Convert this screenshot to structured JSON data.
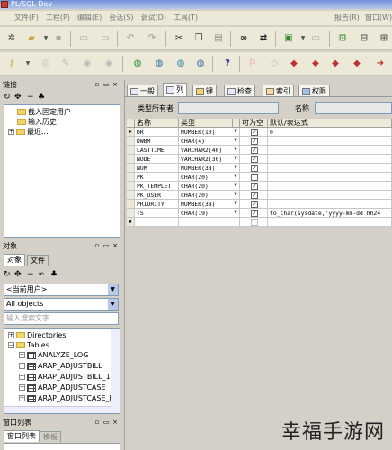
{
  "window": {
    "title": "PL/SQL Dev"
  },
  "menu": {
    "items": [
      "文件(F)",
      "工程(P)",
      "编辑(E)",
      "会话(S)",
      "调试(D)",
      "工具(T)"
    ],
    "right": [
      "报告(R)",
      "窗口(W)"
    ]
  },
  "left_panel": {
    "browser_title": "链接",
    "browser_items": [
      "截入固定用户",
      "输入历史",
      "最近..."
    ],
    "objects_title": "对象",
    "object_tabs": [
      "对象",
      "文件"
    ],
    "user_select": "<当前用户>",
    "type_select": "All objects",
    "search_placeholder": "输入搜索文字",
    "tree": [
      "Directories",
      "Tables",
      "ANALYZE_LOG",
      "ARAP_ADJUSTBILL",
      "ARAP_ADJUSTBILL_1",
      "ARAP_ADJUSTCASE",
      "ARAP_ADJUSTCASE_I"
    ],
    "windows_title": "窗口列表",
    "windows_tabs": [
      "窗口列表",
      "模板"
    ]
  },
  "editor": {
    "tabs": [
      "一般",
      "列",
      "键",
      "检查",
      "索引",
      "权限"
    ],
    "type_owner_label": "类型所有者",
    "name_label": "名称",
    "grid": {
      "headers": [
        "名称",
        "类型",
        "可为空",
        "默认/表达式"
      ],
      "rows": [
        {
          "name": "DR",
          "type": "NUMBER(10)",
          "nullable": true,
          "default": "0"
        },
        {
          "name": "DWBM",
          "type": "CHAR(4)",
          "nullable": true,
          "default": ""
        },
        {
          "name": "LASTTIME",
          "type": "VARCHAR2(40)",
          "nullable": true,
          "default": ""
        },
        {
          "name": "NODE",
          "type": "VARCHAR2(30)",
          "nullable": true,
          "default": ""
        },
        {
          "name": "NUM",
          "type": "NUMBER(38)",
          "nullable": true,
          "default": ""
        },
        {
          "name": "PK",
          "type": "CHAR(20)",
          "nullable": false,
          "default": ""
        },
        {
          "name": "PK_TEMPLET",
          "type": "CHAR(20)",
          "nullable": true,
          "default": ""
        },
        {
          "name": "PK_USER",
          "type": "CHAR(20)",
          "nullable": true,
          "default": ""
        },
        {
          "name": "PRIORITY",
          "type": "NUMBER(38)",
          "nullable": true,
          "default": ""
        },
        {
          "name": "TS",
          "type": "CHAR(19)",
          "nullable": true,
          "default": "to_char(sysdate,'yyyy-mm-dd hh24"
        }
      ]
    }
  },
  "watermark": "幸福手游网"
}
